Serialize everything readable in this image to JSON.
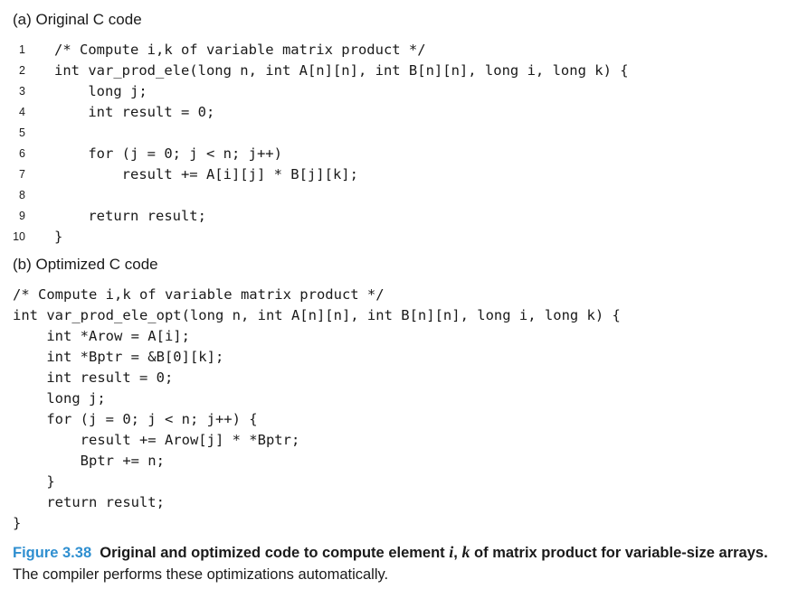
{
  "section_a": {
    "title": "(a) Original C code",
    "lines": [
      {
        "num": "1",
        "code": "/* Compute i,k of variable matrix product */"
      },
      {
        "num": "2",
        "code": "int var_prod_ele(long n, int A[n][n], int B[n][n], long i, long k) {"
      },
      {
        "num": "3",
        "code": "    long j;"
      },
      {
        "num": "4",
        "code": "    int result = 0;"
      },
      {
        "num": "5",
        "code": ""
      },
      {
        "num": "6",
        "code": "    for (j = 0; j < n; j++)"
      },
      {
        "num": "7",
        "code": "        result += A[i][j] * B[j][k];"
      },
      {
        "num": "8",
        "code": ""
      },
      {
        "num": "9",
        "code": "    return result;"
      },
      {
        "num": "10",
        "code": "}"
      }
    ]
  },
  "section_b": {
    "title": "(b) Optimized C code",
    "lines": [
      "/* Compute i,k of variable matrix product */",
      "int var_prod_ele_opt(long n, int A[n][n], int B[n][n], long i, long k) {",
      "    int *Arow = A[i];",
      "    int *Bptr = &B[0][k];",
      "    int result = 0;",
      "    long j;",
      "    for (j = 0; j < n; j++) {",
      "        result += Arow[j] * *Bptr;",
      "        Bptr += n;",
      "    }",
      "    return result;",
      "}"
    ]
  },
  "caption": {
    "label": "Figure 3.38",
    "bold_text_1": "Original and optimized code to compute element ",
    "italic_i": "i",
    "comma": ", ",
    "italic_k": "k",
    "bold_text_2": " of matrix product for variable-size arrays.",
    "normal_text": " The compiler performs these optimizations automatically."
  },
  "colors": {
    "caption_label": "#2f8fd0",
    "text": "#1a1a1a"
  }
}
